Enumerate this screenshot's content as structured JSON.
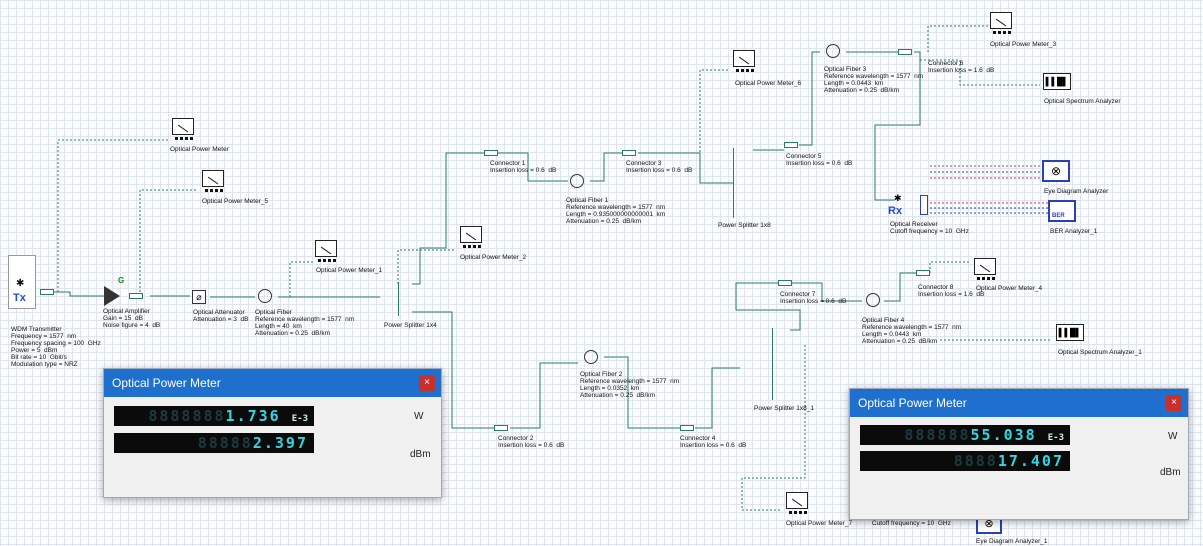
{
  "components": {
    "wdm_tx": {
      "name": "WDM Transmitter",
      "params": [
        "Frequency = 1577  nm",
        "Frequency spacing = 100  GHz",
        "Power = 5  dBm",
        "Bit rate = 10  Gbit/s",
        "Modulation type = NRZ"
      ],
      "icon_text": "Tx"
    },
    "amp": {
      "name": "Optical Amplifier",
      "params": [
        "Gain = 15  dB",
        "Noise figure = 4  dB"
      ],
      "tag": "G"
    },
    "att": {
      "name": "Optical Attenuator",
      "params": [
        "Attenuation = 3  dB"
      ]
    },
    "fiber0": {
      "name": "Optical Fiber",
      "params": [
        "Reference wavelength = 1577  nm",
        "Length = 40  km",
        "Attenuation = 0.25  dB/km"
      ]
    },
    "split4": {
      "name": "Power Splitter 1x4"
    },
    "pm": {
      "name": "Optical Power Meter"
    },
    "pm5": {
      "name": "Optical Power Meter_5"
    },
    "pm1": {
      "name": "Optical Power Meter_1"
    },
    "pm2": {
      "name": "Optical Power Meter_2"
    },
    "pm6": {
      "name": "Optical Power Meter_6"
    },
    "pm3": {
      "name": "Optical Power Meter_3"
    },
    "pm4": {
      "name": "Optical Power Meter_4"
    },
    "pm7": {
      "name": "Optical Power Meter_7"
    },
    "con1": {
      "name": "Connector 1",
      "params": [
        "Insertion loss = 0.6  dB"
      ]
    },
    "con2": {
      "name": "Connector 2",
      "params": [
        "Insertion loss = 0.6  dB"
      ]
    },
    "con3": {
      "name": "Connector 3",
      "params": [
        "Insertion loss = 0.6  dB"
      ]
    },
    "con4": {
      "name": "Connector 4",
      "params": [
        "Insertion loss = 0.6  dB"
      ]
    },
    "con5": {
      "name": "Connector 5",
      "params": [
        "Insertion loss = 0.6  dB"
      ]
    },
    "con6": {
      "name": "Connector 6",
      "params": [
        "Insertion loss = 1.6  dB"
      ]
    },
    "con7": {
      "name": "Connector 7",
      "params": [
        "Insertion loss = 0.6  dB"
      ]
    },
    "con8": {
      "name": "Connector 8",
      "params": [
        "Insertion loss = 1.6  dB"
      ]
    },
    "fiber1": {
      "name": "Optical Fiber 1",
      "params": [
        "Reference wavelength = 1577  nm",
        "Length = 0.935000000000001  km",
        "Attenuation = 0.25  dB/km"
      ]
    },
    "fiber2": {
      "name": "Optical Fiber 2",
      "params": [
        "Reference wavelength = 1577  nm",
        "Length = 0.0352  km",
        "Attenuation = 0.25  dB/km"
      ]
    },
    "fiber3": {
      "name": "Optical Fiber 3",
      "params": [
        "Reference wavelength = 1577  nm",
        "Length = 0.0443  km",
        "Attenuation = 0.25  dB/km"
      ]
    },
    "fiber4": {
      "name": "Optical Fiber 4",
      "params": [
        "Reference wavelength = 1577  nm",
        "Length = 0.0443  km",
        "Attenuation = 0.25  dB/km"
      ]
    },
    "split8": {
      "name": "Power Splitter 1x8"
    },
    "split8_1": {
      "name": "Power Splitter 1x8_1"
    },
    "osa": {
      "name": "Optical Spectrum Analyzer"
    },
    "osa1": {
      "name": "Optical Spectrum Analyzer_1"
    },
    "eye": {
      "name": "Eye Diagram Analyzer"
    },
    "eye1": {
      "name": "Eye Diagram Analyzer_1"
    },
    "ber": {
      "name": "BER Analyzer_1",
      "icon_text": "BER"
    },
    "rx": {
      "name": "Optical Receiver",
      "params": [
        "Cutoff frequency = 10  GHz"
      ],
      "icon_text": "Rx"
    },
    "rx_hidden": {
      "params": [
        "Cutoff frequency = 10  GHz"
      ]
    }
  },
  "dialogs": [
    {
      "title": "Optical Power Meter",
      "close": "×",
      "watt_digits": "1.736",
      "watt_ghost": "8888888",
      "watt_exp": "E-3",
      "watt_unit": "W",
      "dbm_digits": "2.397",
      "dbm_ghost": "88888",
      "dbm_unit": "dBm"
    },
    {
      "title": "Optical Power Meter",
      "close": "×",
      "watt_digits": "55.038",
      "watt_ghost": "888888",
      "watt_exp": "E-3",
      "watt_unit": "W",
      "dbm_digits": "17.407",
      "dbm_ghost": "8888",
      "dbm_unit": "dBm"
    }
  ],
  "colors": {
    "wire": "#2a7a6e",
    "dashed_wire": "#2a7a6e",
    "dialog_header": "#1f6fcf",
    "lcd_digit": "#33d6e0",
    "close": "#c9302c",
    "electrical_red": "#c23b3b",
    "electrical_blue": "#2b3fb8"
  }
}
